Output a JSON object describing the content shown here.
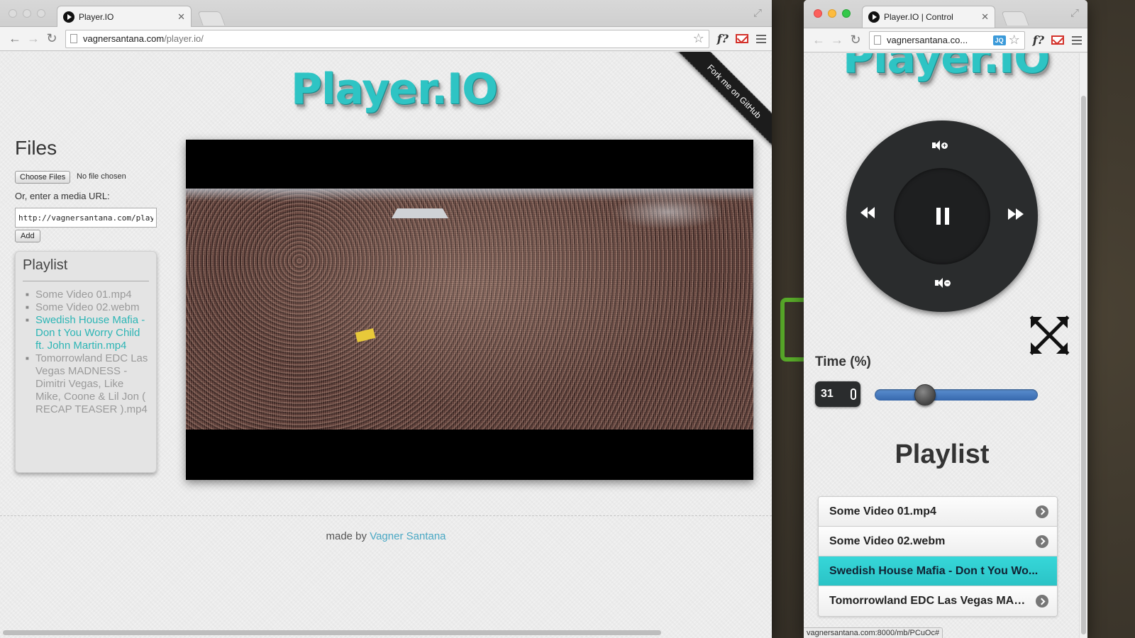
{
  "left_window": {
    "tab": {
      "title": "Player.IO"
    },
    "omnibox": {
      "host": "vagnersantana.com",
      "path": "/player.io/"
    },
    "page": {
      "logo": "Player.IO",
      "ribbon": "Fork me on GitHub",
      "files": {
        "title": "Files",
        "choose_label": "Choose Files",
        "no_file": "No file chosen",
        "or_label": "Or, enter a media URL:",
        "url_value": "http://vagnersantana.com/player.io",
        "add_label": "Add"
      },
      "playlist": {
        "title": "Playlist",
        "items": [
          "Some Video 01.mp4",
          "Some Video 02.webm",
          "Swedish House Mafia - Don t You Worry Child ft. John Martin.mp4",
          "Tomorrowland EDC Las Vegas MADNESS - Dimitri Vegas, Like Mike, Coone & Lil Jon ( RECAP TEASER ).mp4"
        ],
        "active_index": 2
      },
      "footer": {
        "made_by": "made by",
        "author": "Vagner Santana"
      }
    }
  },
  "right_window": {
    "tab": {
      "title": "Player.IO | Control"
    },
    "omnibox": {
      "host": "vagnersantana.co..."
    },
    "page": {
      "logo": "Player.IO",
      "time_label": "Time (%)",
      "time_value": "31",
      "time_fraction": 0.31,
      "playlist_title": "Playlist",
      "items": [
        "Some Video 01.mp4",
        "Some Video 02.webm",
        "Swedish House Mafia - Don t You Wo...",
        "Tomorrowland EDC Las Vegas MAD..."
      ],
      "active_index": 2
    },
    "status_url": "vagnersantana.com:8000/mb/PCuOc#"
  },
  "colors": {
    "accent": "#2ec4c4",
    "active_item": "#36d7d9",
    "slider": "#3668ad",
    "dial": "#2a2c2d"
  },
  "icons": [
    "back-arrow-icon",
    "forward-arrow-icon",
    "reload-icon",
    "star-icon",
    "menu-icon",
    "play-icon",
    "pause-icon",
    "rewind-icon",
    "fast-forward-icon",
    "volume-up-icon",
    "volume-down-icon",
    "expand-icon",
    "chevron-right-icon"
  ]
}
